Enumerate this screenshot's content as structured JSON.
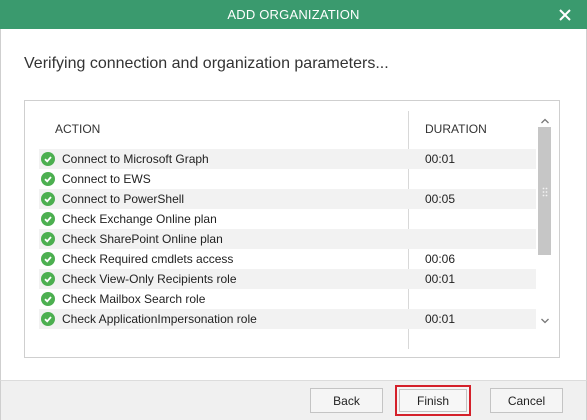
{
  "window": {
    "title": "ADD ORGANIZATION",
    "close_icon": "close-icon",
    "accent_color": "#3a9a6e"
  },
  "main": {
    "heading": "Verifying connection and organization parameters..."
  },
  "grid": {
    "columns": [
      "ACTION",
      "DURATION"
    ],
    "status_icon": "check-circle-icon",
    "status_color": "#4caf50",
    "rows": [
      {
        "action": "Connect to Microsoft Graph",
        "duration": "00:01"
      },
      {
        "action": "Connect to EWS",
        "duration": ""
      },
      {
        "action": "Connect to PowerShell",
        "duration": "00:05"
      },
      {
        "action": "Check Exchange Online plan",
        "duration": ""
      },
      {
        "action": "Check SharePoint Online plan",
        "duration": ""
      },
      {
        "action": "Check Required cmdlets access",
        "duration": "00:06"
      },
      {
        "action": "Check View-Only Recipients role",
        "duration": "00:01"
      },
      {
        "action": "Check Mailbox Search role",
        "duration": ""
      },
      {
        "action": "Check ApplicationImpersonation role",
        "duration": "00:01"
      }
    ]
  },
  "footer": {
    "back_label": "Back",
    "finish_label": "Finish",
    "cancel_label": "Cancel",
    "highlight_color": "#d4202a"
  }
}
